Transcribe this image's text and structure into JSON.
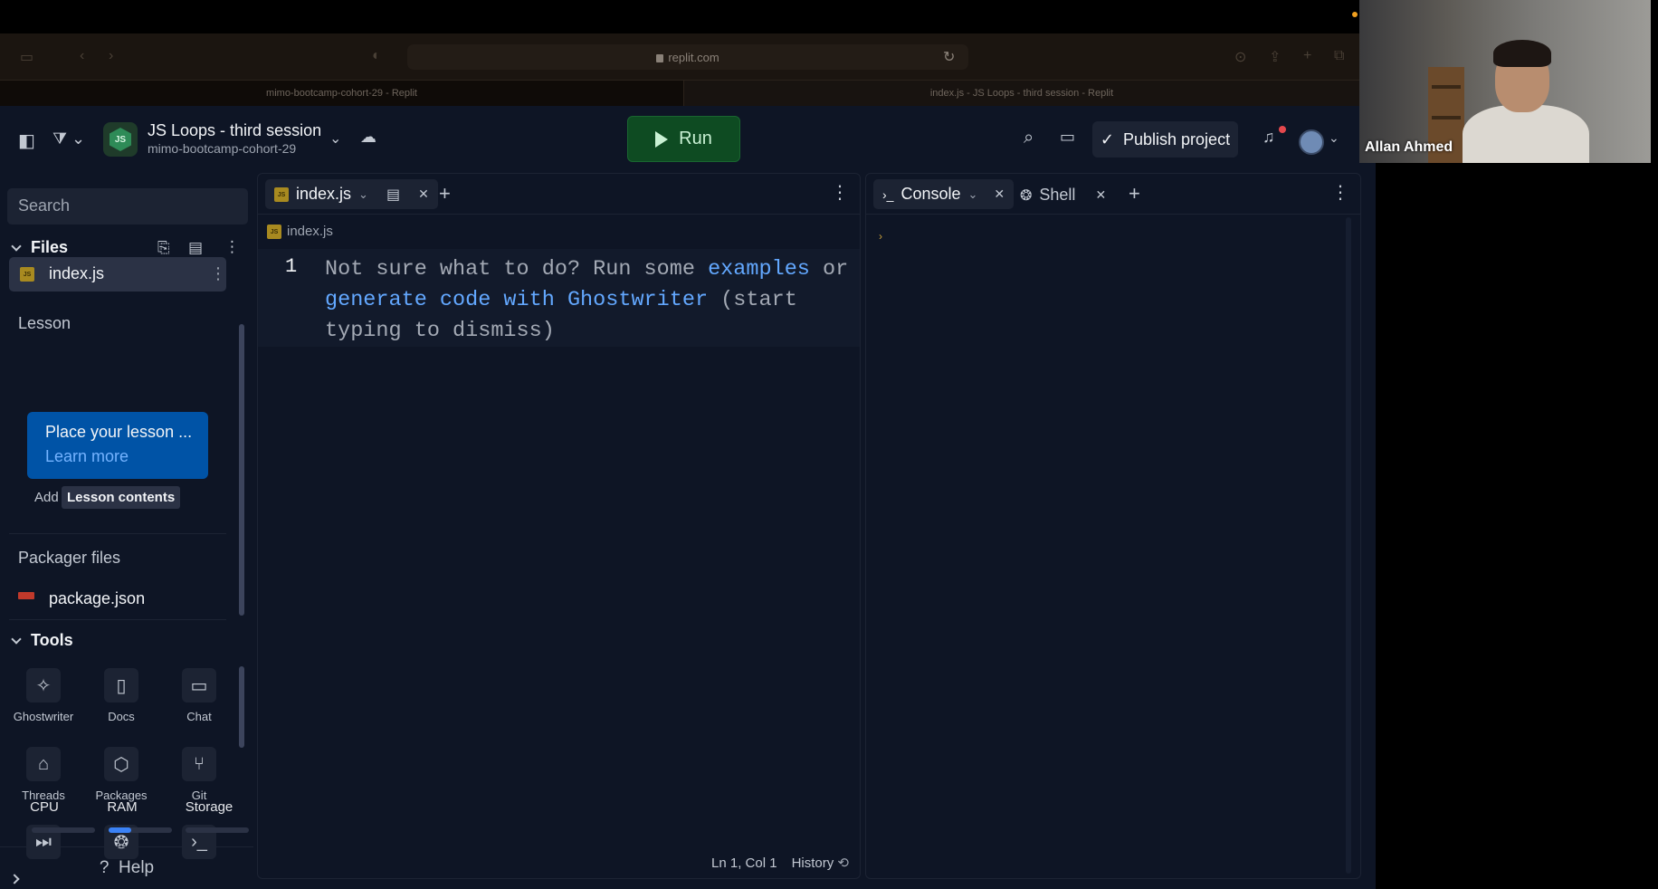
{
  "browser": {
    "url": "replit.com",
    "tabs": [
      "mimo-bootcamp-cohort-29 - Replit",
      "index.js - JS Loops - third session - Replit"
    ]
  },
  "header": {
    "project_title": "JS Loops - third session",
    "project_subtitle": "mimo-bootcamp-cohort-29",
    "run_label": "Run",
    "publish_label": "Publish project"
  },
  "sidebar": {
    "search_placeholder": "Search",
    "files_heading": "Files",
    "files": [
      {
        "name": "index.js",
        "icon": "js-file-icon"
      }
    ],
    "lesson_heading": "Lesson",
    "lesson_card_text": "Place your lesson ...",
    "lesson_card_link": "Learn more",
    "add_label": "Add",
    "tooltip": "Lesson contents",
    "packager_heading": "Packager files",
    "packager_files": [
      {
        "name": "package.json",
        "icon": "npm-icon"
      }
    ],
    "tools_heading": "Tools",
    "tools": [
      {
        "label": "Ghostwriter",
        "icon": "ghostwriter-icon"
      },
      {
        "label": "Docs",
        "icon": "book-icon"
      },
      {
        "label": "Chat",
        "icon": "chat-icon"
      },
      {
        "label": "Threads",
        "icon": "inbox-icon"
      },
      {
        "label": "Packages",
        "icon": "package-icon"
      },
      {
        "label": "Git",
        "icon": "git-icon"
      }
    ],
    "resources": [
      {
        "label": "CPU",
        "usage": 0.0
      },
      {
        "label": "RAM",
        "usage": 0.35
      },
      {
        "label": "Storage",
        "usage": 0.0
      }
    ],
    "help_label": "Help"
  },
  "editor": {
    "tab_label": "index.js",
    "breadcrumb": "index.js",
    "line_number": "1",
    "hint_prefix": "Not sure what to do? Run some ",
    "hint_link1": "examples",
    "hint_mid": " or ",
    "hint_link2": "generate code with Ghostwriter",
    "hint_suffix": " (start typing to dismiss)",
    "cursor_position": "Ln 1, Col 1",
    "history_label": "History"
  },
  "console_pane": {
    "tabs": [
      {
        "label": "Console",
        "active": true
      },
      {
        "label": "Shell",
        "active": false
      }
    ],
    "prompt_symbol": "›"
  },
  "video": {
    "participant_name": "Allan Ahmed"
  },
  "colors": {
    "background": "#0e1525",
    "surface": "#1c2333",
    "run_green": "#0e4b22",
    "link_blue": "#63a8ff",
    "lesson_blue": "#0053a6"
  }
}
